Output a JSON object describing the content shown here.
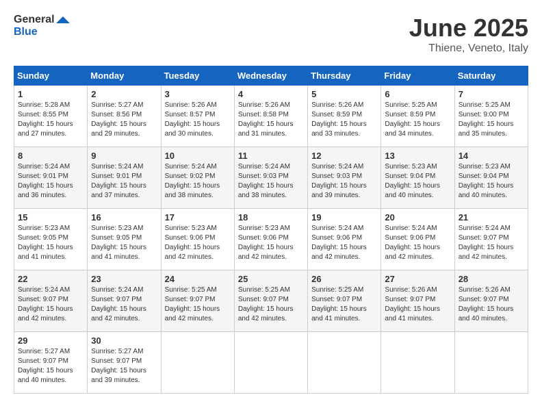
{
  "header": {
    "logo_general": "General",
    "logo_blue": "Blue",
    "month_year": "June 2025",
    "location": "Thiene, Veneto, Italy"
  },
  "calendar": {
    "days_of_week": [
      "Sunday",
      "Monday",
      "Tuesday",
      "Wednesday",
      "Thursday",
      "Friday",
      "Saturday"
    ],
    "weeks": [
      [
        {
          "day": "1",
          "sunrise": "5:28 AM",
          "sunset": "8:55 PM",
          "daylight": "15 hours and 27 minutes."
        },
        {
          "day": "2",
          "sunrise": "5:27 AM",
          "sunset": "8:56 PM",
          "daylight": "15 hours and 29 minutes."
        },
        {
          "day": "3",
          "sunrise": "5:26 AM",
          "sunset": "8:57 PM",
          "daylight": "15 hours and 30 minutes."
        },
        {
          "day": "4",
          "sunrise": "5:26 AM",
          "sunset": "8:58 PM",
          "daylight": "15 hours and 31 minutes."
        },
        {
          "day": "5",
          "sunrise": "5:26 AM",
          "sunset": "8:59 PM",
          "daylight": "15 hours and 33 minutes."
        },
        {
          "day": "6",
          "sunrise": "5:25 AM",
          "sunset": "8:59 PM",
          "daylight": "15 hours and 34 minutes."
        },
        {
          "day": "7",
          "sunrise": "5:25 AM",
          "sunset": "9:00 PM",
          "daylight": "15 hours and 35 minutes."
        }
      ],
      [
        {
          "day": "8",
          "sunrise": "5:24 AM",
          "sunset": "9:01 PM",
          "daylight": "15 hours and 36 minutes."
        },
        {
          "day": "9",
          "sunrise": "5:24 AM",
          "sunset": "9:01 PM",
          "daylight": "15 hours and 37 minutes."
        },
        {
          "day": "10",
          "sunrise": "5:24 AM",
          "sunset": "9:02 PM",
          "daylight": "15 hours and 38 minutes."
        },
        {
          "day": "11",
          "sunrise": "5:24 AM",
          "sunset": "9:03 PM",
          "daylight": "15 hours and 38 minutes."
        },
        {
          "day": "12",
          "sunrise": "5:24 AM",
          "sunset": "9:03 PM",
          "daylight": "15 hours and 39 minutes."
        },
        {
          "day": "13",
          "sunrise": "5:23 AM",
          "sunset": "9:04 PM",
          "daylight": "15 hours and 40 minutes."
        },
        {
          "day": "14",
          "sunrise": "5:23 AM",
          "sunset": "9:04 PM",
          "daylight": "15 hours and 40 minutes."
        }
      ],
      [
        {
          "day": "15",
          "sunrise": "5:23 AM",
          "sunset": "9:05 PM",
          "daylight": "15 hours and 41 minutes."
        },
        {
          "day": "16",
          "sunrise": "5:23 AM",
          "sunset": "9:05 PM",
          "daylight": "15 hours and 41 minutes."
        },
        {
          "day": "17",
          "sunrise": "5:23 AM",
          "sunset": "9:06 PM",
          "daylight": "15 hours and 42 minutes."
        },
        {
          "day": "18",
          "sunrise": "5:23 AM",
          "sunset": "9:06 PM",
          "daylight": "15 hours and 42 minutes."
        },
        {
          "day": "19",
          "sunrise": "5:24 AM",
          "sunset": "9:06 PM",
          "daylight": "15 hours and 42 minutes."
        },
        {
          "day": "20",
          "sunrise": "5:24 AM",
          "sunset": "9:06 PM",
          "daylight": "15 hours and 42 minutes."
        },
        {
          "day": "21",
          "sunrise": "5:24 AM",
          "sunset": "9:07 PM",
          "daylight": "15 hours and 42 minutes."
        }
      ],
      [
        {
          "day": "22",
          "sunrise": "5:24 AM",
          "sunset": "9:07 PM",
          "daylight": "15 hours and 42 minutes."
        },
        {
          "day": "23",
          "sunrise": "5:24 AM",
          "sunset": "9:07 PM",
          "daylight": "15 hours and 42 minutes."
        },
        {
          "day": "24",
          "sunrise": "5:25 AM",
          "sunset": "9:07 PM",
          "daylight": "15 hours and 42 minutes."
        },
        {
          "day": "25",
          "sunrise": "5:25 AM",
          "sunset": "9:07 PM",
          "daylight": "15 hours and 42 minutes."
        },
        {
          "day": "26",
          "sunrise": "5:25 AM",
          "sunset": "9:07 PM",
          "daylight": "15 hours and 41 minutes."
        },
        {
          "day": "27",
          "sunrise": "5:26 AM",
          "sunset": "9:07 PM",
          "daylight": "15 hours and 41 minutes."
        },
        {
          "day": "28",
          "sunrise": "5:26 AM",
          "sunset": "9:07 PM",
          "daylight": "15 hours and 40 minutes."
        }
      ],
      [
        {
          "day": "29",
          "sunrise": "5:27 AM",
          "sunset": "9:07 PM",
          "daylight": "15 hours and 40 minutes."
        },
        {
          "day": "30",
          "sunrise": "5:27 AM",
          "sunset": "9:07 PM",
          "daylight": "15 hours and 39 minutes."
        },
        null,
        null,
        null,
        null,
        null
      ]
    ]
  }
}
